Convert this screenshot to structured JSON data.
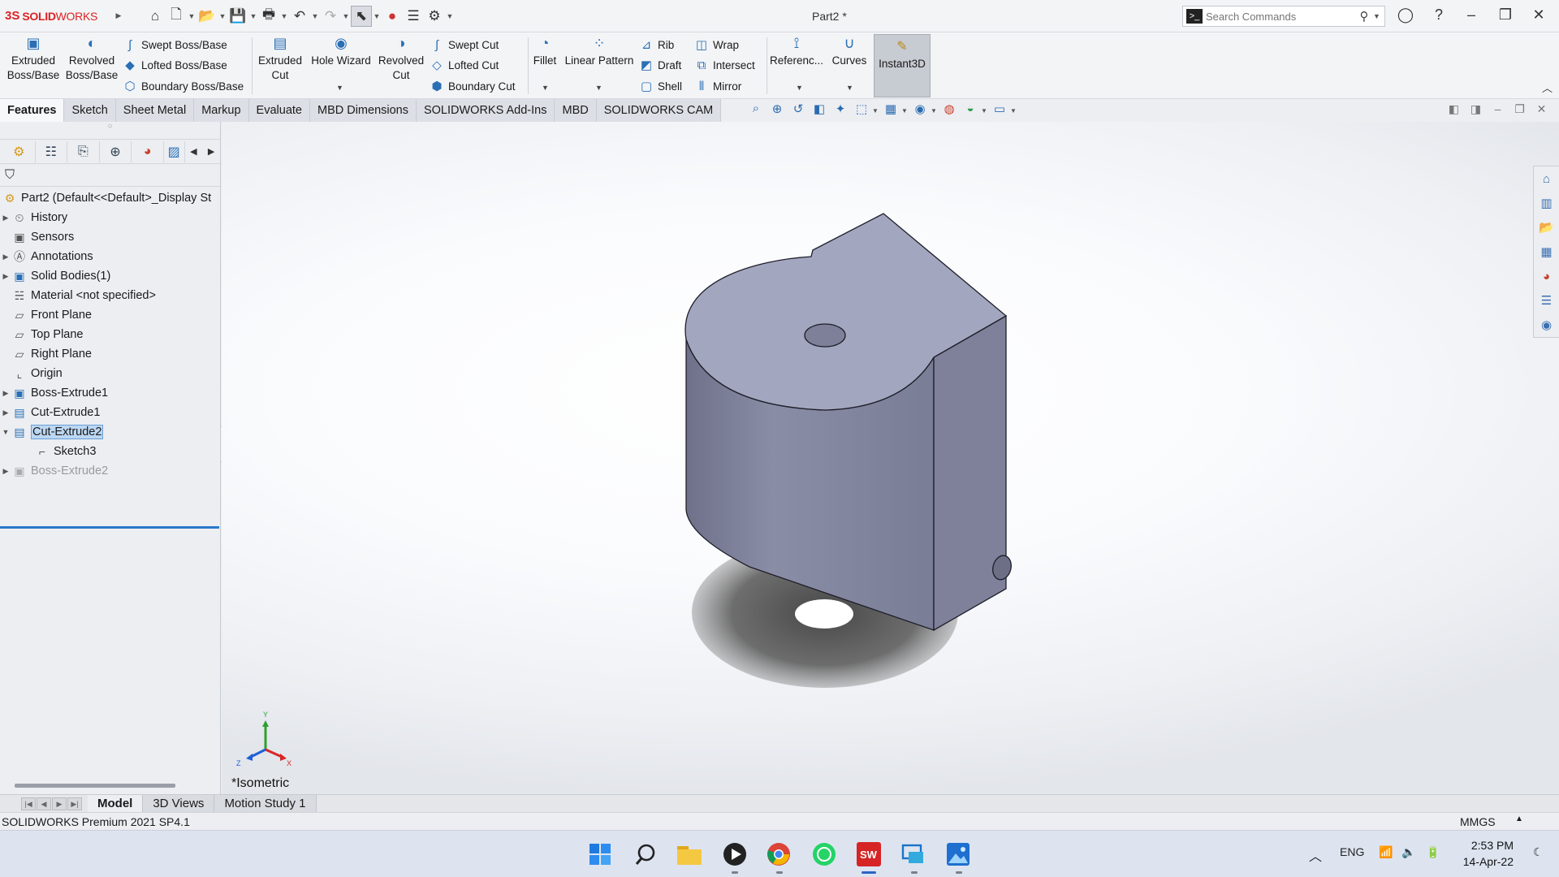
{
  "titlebar": {
    "logo_prefix": "3S",
    "logo_text_bold": "SOLID",
    "logo_text_rest": "WORKS",
    "doc_title": "Part2 *",
    "search_placeholder": "Search Commands"
  },
  "command_manager": {
    "extruded_boss": [
      "Extruded",
      "Boss/Base"
    ],
    "revolved_boss": [
      "Revolved",
      "Boss/Base"
    ],
    "swept_boss": "Swept Boss/Base",
    "lofted_boss": "Lofted Boss/Base",
    "boundary_boss": "Boundary Boss/Base",
    "extruded_cut": [
      "Extruded",
      "Cut"
    ],
    "hole_wizard": "Hole Wizard",
    "revolved_cut": [
      "Revolved",
      "Cut"
    ],
    "swept_cut": "Swept Cut",
    "lofted_cut": "Lofted Cut",
    "boundary_cut": "Boundary Cut",
    "fillet": "Fillet",
    "linear_pattern": "Linear Pattern",
    "rib": "Rib",
    "draft": "Draft",
    "shell": "Shell",
    "wrap": "Wrap",
    "intersect": "Intersect",
    "mirror": "Mirror",
    "reference": "Referenc...",
    "curves": "Curves",
    "instant3d": "Instant3D"
  },
  "tabs": [
    "Features",
    "Sketch",
    "Sheet Metal",
    "Markup",
    "Evaluate",
    "MBD Dimensions",
    "SOLIDWORKS Add-Ins",
    "MBD",
    "SOLIDWORKS CAM"
  ],
  "active_tab": "Features",
  "feature_tree": {
    "root": "Part2  (Default<<Default>_Display St",
    "items": [
      {
        "label": "History",
        "icon": "history-folder-icon"
      },
      {
        "label": "Sensors",
        "icon": "sensors-icon"
      },
      {
        "label": "Annotations",
        "icon": "annotations-icon"
      },
      {
        "label": "Solid Bodies(1)",
        "icon": "solid-bodies-icon"
      },
      {
        "label": "Material <not specified>",
        "icon": "material-icon"
      },
      {
        "label": "Front Plane",
        "icon": "plane-icon"
      },
      {
        "label": "Top Plane",
        "icon": "plane-icon"
      },
      {
        "label": "Right Plane",
        "icon": "plane-icon"
      },
      {
        "label": "Origin",
        "icon": "origin-icon"
      },
      {
        "label": "Boss-Extrude1",
        "icon": "boss-extrude-icon"
      },
      {
        "label": "Cut-Extrude1",
        "icon": "cut-extrude-icon"
      },
      {
        "label": "Cut-Extrude2",
        "icon": "cut-extrude-icon"
      },
      {
        "label": "Sketch3",
        "icon": "sketch-icon"
      },
      {
        "label": "Boss-Extrude2",
        "icon": "boss-extrude-icon"
      }
    ]
  },
  "viewport": {
    "view_name": "*Isometric",
    "triad": {
      "x": "X",
      "y": "Y",
      "z": "Z"
    }
  },
  "bottom_tabs": [
    "Model",
    "3D Views",
    "Motion Study 1"
  ],
  "active_bottom_tab": "Model",
  "status": {
    "product": "SOLIDWORKS Premium 2021 SP4.1",
    "units": "MMGS"
  },
  "taskbar": {
    "language": "ENG",
    "time": "2:53 PM",
    "date": "14-Apr-22"
  },
  "colors": {
    "accent": "#2a78c8",
    "model_top": "#a2a5bf",
    "model_side": "#7d8097",
    "model_front": "#8e91aa",
    "brand_red": "#dd2222"
  }
}
